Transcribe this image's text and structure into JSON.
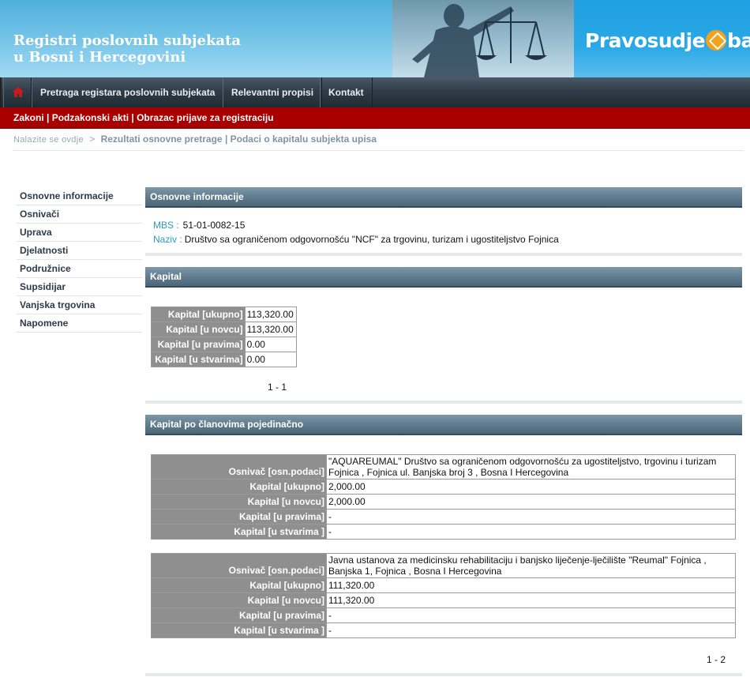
{
  "header": {
    "title_line1": "Registri poslovnih subjekata",
    "title_line2": "u Bosni i Hercegovini",
    "logo_left": "Pravosudje",
    "logo_right": "ba"
  },
  "nav": {
    "items": [
      {
        "label": "Pretraga registara poslovnih subjekata"
      },
      {
        "label": "Relevantni propisi"
      },
      {
        "label": "Kontakt"
      }
    ],
    "sub_items": "Zakoni | Podzakonski akti | Obrazac prijave za registraciju"
  },
  "breadcrumb": {
    "label": "Nalazite se ovdje",
    "separator": ">",
    "current": "Rezultati osnovne pretrage | Podaci o kapitalu subjekta upisa"
  },
  "sidebar": {
    "items": [
      {
        "label": "Osnovne informacije"
      },
      {
        "label": "Osnivači"
      },
      {
        "label": "Uprava"
      },
      {
        "label": "Djelatnosti"
      },
      {
        "label": "Podružnice"
      },
      {
        "label": "Supsidijar"
      },
      {
        "label": "Vanjska trgovina"
      },
      {
        "label": "Napomene"
      }
    ]
  },
  "basic": {
    "heading": "Osnovne informacije",
    "mbs_label": "MBS :",
    "mbs_value": "51-01-0082-15",
    "naziv_label": "Naziv :",
    "naziv_value": "Društvo sa ograničenom odgovornošću \"NCF\" za trgovinu, turizam i ugostiteljstvo Fojnica"
  },
  "kapital": {
    "heading": "Kapital",
    "rows": [
      {
        "label": "Kapital [ukupno]",
        "value": "113,320.00"
      },
      {
        "label": "Kapital [u novcu]",
        "value": "113,320.00"
      },
      {
        "label": "Kapital [u pravima]",
        "value": "0.00"
      },
      {
        "label": "Kapital [u stvarima]",
        "value": "0.00"
      }
    ],
    "pager": "1 - 1"
  },
  "members": {
    "heading": "Kapital po članovima pojedinačno",
    "entries": [
      {
        "founder_label": "Osnivač [osn.podaci]",
        "founder_line1": "\"AQUAREUMAL\" Društvo sa ograničenom odgovornošću za ugostiteljstvo, trgovinu i turizam",
        "founder_line2": "Fojnica , Fojnica ul. Banjska broj 3 , Bosna I Hercegovina",
        "rows": [
          {
            "label": "Kapital [ukupno]",
            "value": "2,000.00"
          },
          {
            "label": "Kapital [u novcu]",
            "value": "2,000.00"
          },
          {
            "label": "Kapital [u pravima]",
            "value": "-"
          },
          {
            "label": "Kapital [u stvarima ]",
            "value": "-"
          }
        ]
      },
      {
        "founder_label": "Osnivač [osn.podaci]",
        "founder_line1": "Javna ustanova za medicinsku rehabilitaciju i banjsko liječenje-lječilište \"Reumal\" Fojnica ,",
        "founder_line2": "Banjska 1, Fojnica , Bosna I Hercegovina",
        "rows": [
          {
            "label": "Kapital [ukupno]",
            "value": "111,320.00"
          },
          {
            "label": "Kapital [u novcu]",
            "value": "111,320.00"
          },
          {
            "label": "Kapital [u pravima]",
            "value": "-"
          },
          {
            "label": "Kapital [u stvarima ]",
            "value": "-"
          }
        ]
      }
    ],
    "pager": "1 - 2"
  }
}
